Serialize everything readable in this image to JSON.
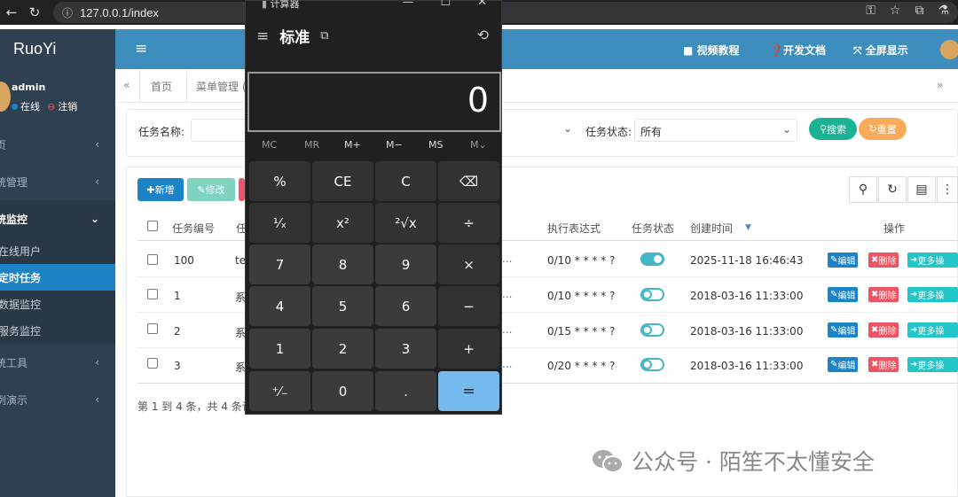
{
  "browser": {
    "url": "127.0.0.1/index",
    "nav_icons": [
      "back-arrow-icon",
      "reload-icon"
    ]
  },
  "sidebar": {
    "logo": "RuoYi",
    "user": {
      "name": "admin",
      "online_label": "在线",
      "logout_label": "注销"
    },
    "menus": [
      {
        "label": "页",
        "active": false
      },
      {
        "label": "统管理",
        "active": false
      },
      {
        "label": "统监控",
        "active": true
      }
    ],
    "submenus": [
      {
        "label": "在线用户",
        "current": false
      },
      {
        "label": "定时任务",
        "current": true
      },
      {
        "label": "数据监控",
        "current": false
      },
      {
        "label": "服务监控",
        "current": false
      }
    ],
    "menus_after": [
      {
        "label": "统工具"
      },
      {
        "label": "例演示"
      }
    ]
  },
  "header": {
    "video_label": "视频教程",
    "docs_label": "开发文档",
    "fullscreen_label": "全屏显示"
  },
  "tabs": {
    "home": "首页",
    "menu": "菜单管理 ("
  },
  "search": {
    "task_name_label": "任务名称:",
    "task_status_label": "任务状态:",
    "task_status_value": "所有",
    "search_button": "搜索",
    "reset_button": "重置"
  },
  "toolbar": {
    "add_label": "新增",
    "edit_label": "修改"
  },
  "table": {
    "headers": {
      "id": "任务编号",
      "name": "任",
      "cron": "执行表达式",
      "status": "任务状态",
      "created": "创建时间",
      "actions": "操作"
    },
    "rows": [
      {
        "id": "100",
        "name": "te",
        "trail": "...",
        "cron": "0/10 * * * * ?",
        "status": "on",
        "created": "2025-11-18 16:46:43"
      },
      {
        "id": "1",
        "name": "系",
        "trail": "...",
        "cron": "0/10 * * * * ?",
        "status": "off",
        "created": "2018-03-16 11:33:00"
      },
      {
        "id": "2",
        "name": "系",
        "trail": "...",
        "cron": "0/15 * * * * ?",
        "status": "off",
        "created": "2018-03-16 11:33:00"
      },
      {
        "id": "3",
        "name": "系",
        "trail": "...",
        "cron": "0/20 * * * * ?",
        "status": "off",
        "created": "2018-03-16 11:33:00"
      }
    ],
    "row_actions": {
      "edit": "编辑",
      "delete": "删除",
      "more": "更多操"
    },
    "pagination": "第 1 到 4 条，共 4 条记"
  },
  "calculator": {
    "title": "计算器",
    "mode": "标准",
    "display": "0",
    "memory_keys": [
      "MC",
      "MR",
      "M+",
      "M−",
      "MS",
      "M⌄"
    ],
    "keys": [
      [
        "%",
        "CE",
        "C",
        "⌫"
      ],
      [
        "¹⁄ₓ",
        "x²",
        "²√x",
        "÷"
      ],
      [
        "7",
        "8",
        "9",
        "×"
      ],
      [
        "4",
        "5",
        "6",
        "−"
      ],
      [
        "1",
        "2",
        "3",
        "+"
      ],
      [
        "⁺⁄₋",
        "0",
        ".",
        "="
      ]
    ]
  },
  "watermark": {
    "text": "公众号 · 陌笙不太懂安全"
  },
  "colors": {
    "sidebar": "#2f4050",
    "header": "#3c8dbc",
    "primary": "#1c84c6",
    "success": "#1ab394",
    "warning": "#f8ac59",
    "danger": "#ed5565",
    "info": "#23c6c8",
    "calc_equals": "#76b9ed"
  }
}
